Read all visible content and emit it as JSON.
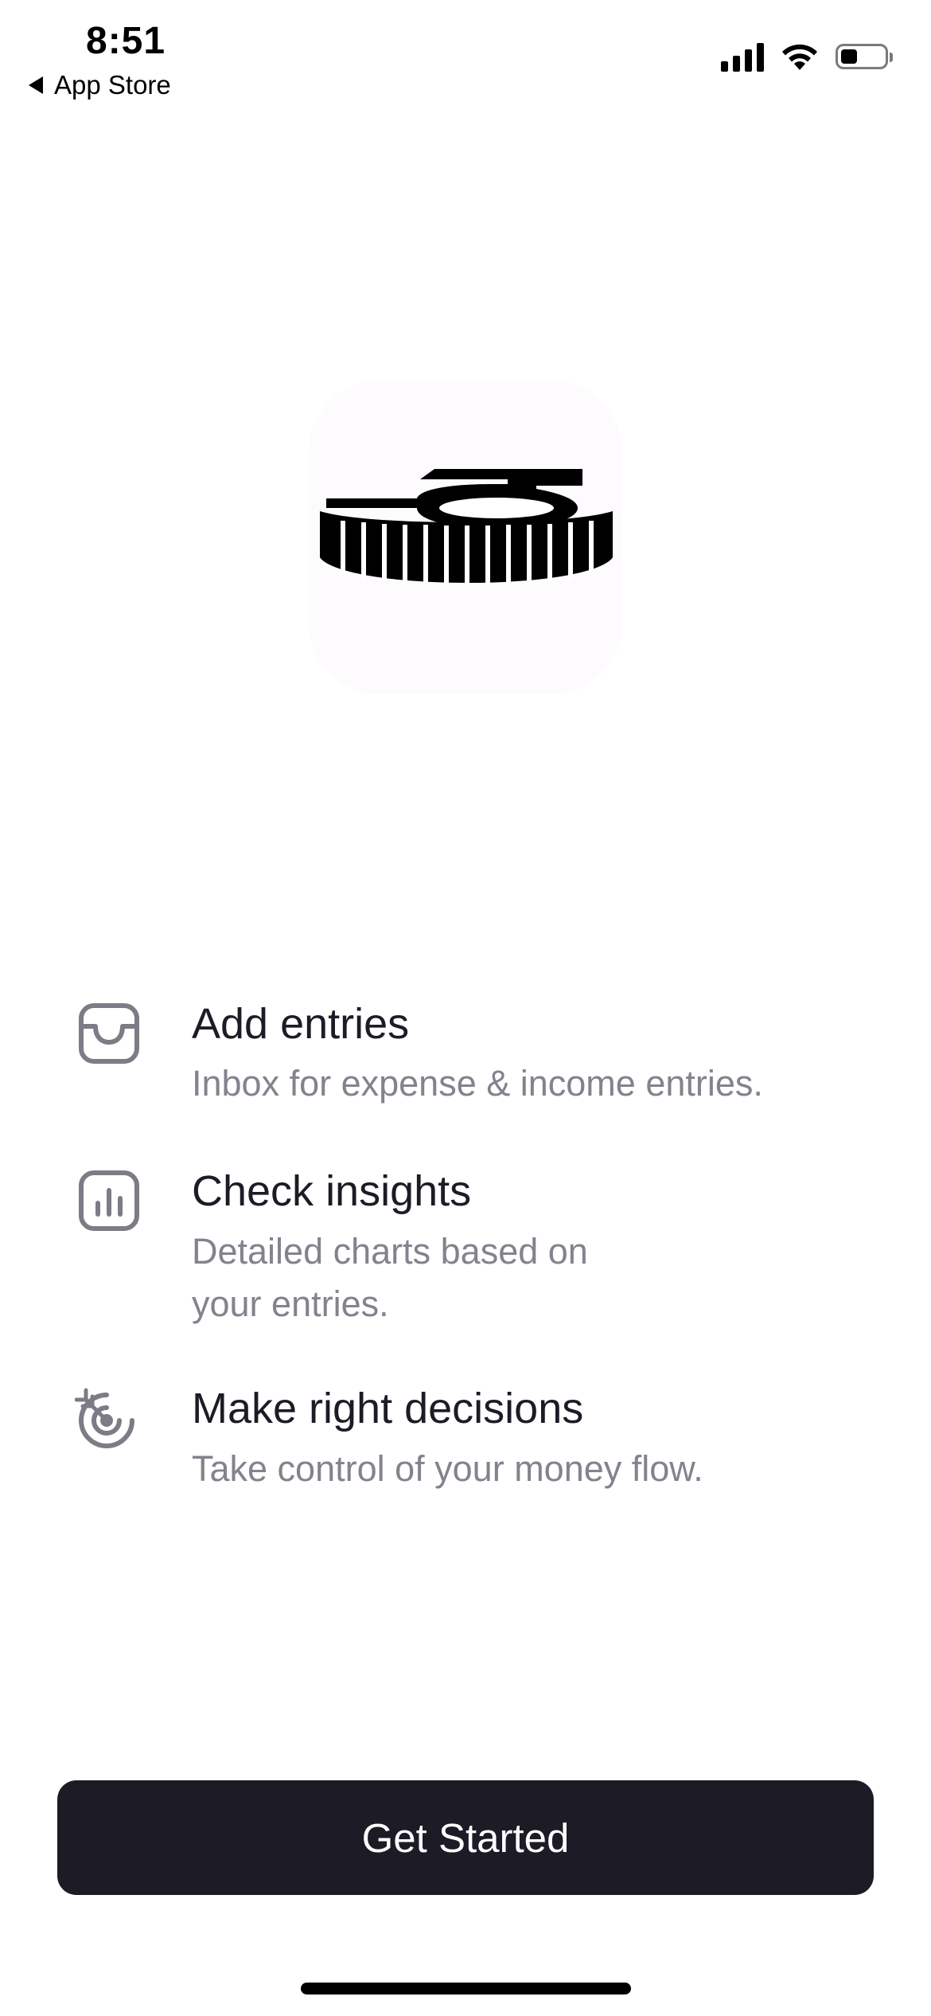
{
  "status_bar": {
    "time": "8:51",
    "back_label": "App Store"
  },
  "features": [
    {
      "icon": "inbox-icon",
      "title": "Add entries",
      "description": "Inbox for expense & income entries."
    },
    {
      "icon": "chart-icon",
      "title": "Check insights",
      "description_line1": "Detailed charts based on",
      "description_line2": "your entries."
    },
    {
      "icon": "target-icon",
      "title": "Make right decisions",
      "description": "Take control of your money flow."
    }
  ],
  "cta": {
    "label": "Get Started"
  },
  "colors": {
    "primary": "#1c1b26",
    "secondary_text": "#83828d",
    "icon_gray": "#7d7c86",
    "background": "#ffffff"
  }
}
